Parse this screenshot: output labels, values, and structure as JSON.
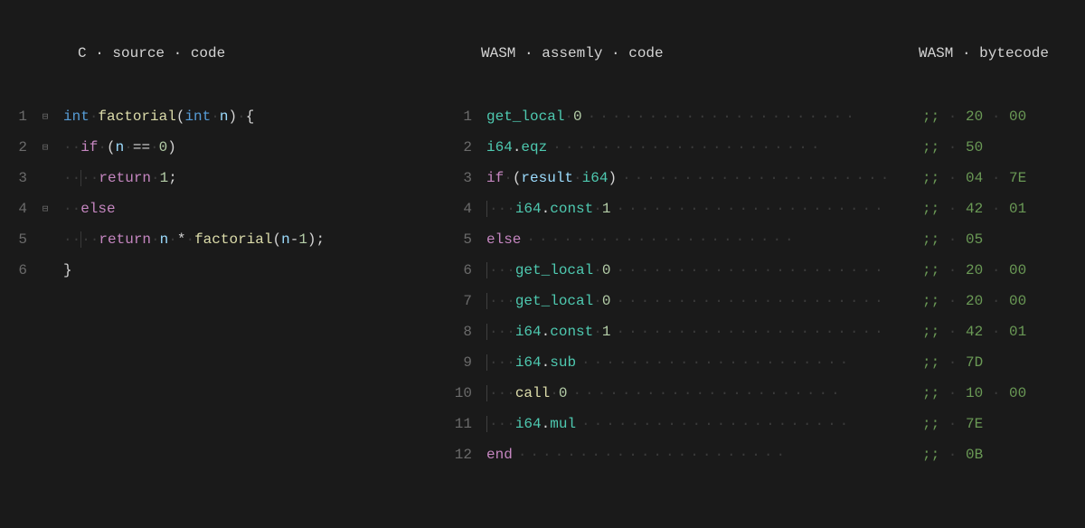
{
  "headers": {
    "c": "C source code",
    "asm": "WASM assemly code",
    "byte": "WASM bytecode"
  },
  "c_lines": [
    {
      "n": "1",
      "fold": "⊟",
      "indent": 0,
      "tokens": [
        [
          "kw-type",
          "int"
        ],
        [
          "ws",
          " "
        ],
        [
          "fn",
          "factorial"
        ],
        [
          "paren",
          "("
        ],
        [
          "kw-type",
          "int"
        ],
        [
          "ws",
          " "
        ],
        [
          "ident",
          "n"
        ],
        [
          "paren",
          ")"
        ],
        [
          "ws",
          " "
        ],
        [
          "punct",
          "{"
        ]
      ]
    },
    {
      "n": "2",
      "fold": "⊟",
      "indent": 1,
      "tokens": [
        [
          "kw-ctrl",
          "if"
        ],
        [
          "ws",
          " "
        ],
        [
          "paren",
          "("
        ],
        [
          "ident",
          "n"
        ],
        [
          "ws",
          " "
        ],
        [
          "op",
          "=="
        ],
        [
          "ws",
          " "
        ],
        [
          "num",
          "0"
        ],
        [
          "paren",
          ")"
        ]
      ]
    },
    {
      "n": "3",
      "fold": "",
      "indent": 2,
      "tokens": [
        [
          "kw-ctrl",
          "return"
        ],
        [
          "ws",
          " "
        ],
        [
          "num",
          "1"
        ],
        [
          "punct",
          ";"
        ]
      ]
    },
    {
      "n": "4",
      "fold": "⊟",
      "indent": 1,
      "tokens": [
        [
          "kw-ctrl",
          "else"
        ]
      ]
    },
    {
      "n": "5",
      "fold": "",
      "indent": 2,
      "tokens": [
        [
          "kw-ctrl",
          "return"
        ],
        [
          "ws",
          " "
        ],
        [
          "ident",
          "n"
        ],
        [
          "ws",
          " "
        ],
        [
          "op",
          "*"
        ],
        [
          "ws",
          " "
        ],
        [
          "fn",
          "factorial"
        ],
        [
          "paren",
          "("
        ],
        [
          "ident",
          "n"
        ],
        [
          "op",
          "-"
        ],
        [
          "num",
          "1"
        ],
        [
          "paren",
          ")"
        ],
        [
          "punct",
          ";"
        ]
      ]
    },
    {
      "n": "6",
      "fold": "",
      "indent": 0,
      "tokens": [
        [
          "punct",
          "}"
        ]
      ]
    }
  ],
  "wasm_lines": [
    {
      "n": "1",
      "indent": 0,
      "tokens": [
        [
          "wasm-op",
          "get_local"
        ],
        [
          "ws",
          " "
        ],
        [
          "num",
          "0"
        ]
      ],
      "bytes": ";; 20 00"
    },
    {
      "n": "2",
      "indent": 0,
      "tokens": [
        [
          "wasm-op",
          "i64"
        ],
        [
          "punct",
          "."
        ],
        [
          "wasm-op",
          "eqz"
        ]
      ],
      "bytes": ";; 50"
    },
    {
      "n": "3",
      "indent": 0,
      "tokens": [
        [
          "wasm-kw",
          "if"
        ],
        [
          "ws",
          " "
        ],
        [
          "paren",
          "("
        ],
        [
          "ident",
          "result"
        ],
        [
          "ws",
          " "
        ],
        [
          "wasm-op",
          "i64"
        ],
        [
          "paren",
          ")"
        ]
      ],
      "bytes": ";; 04 7E"
    },
    {
      "n": "4",
      "indent": 1,
      "tokens": [
        [
          "wasm-op",
          "i64"
        ],
        [
          "punct",
          "."
        ],
        [
          "wasm-op",
          "const"
        ],
        [
          "ws",
          " "
        ],
        [
          "num",
          "1"
        ]
      ],
      "bytes": ";; 42 01"
    },
    {
      "n": "5",
      "indent": 0,
      "tokens": [
        [
          "wasm-kw",
          "else"
        ]
      ],
      "bytes": ";; 05"
    },
    {
      "n": "6",
      "indent": 1,
      "tokens": [
        [
          "wasm-op",
          "get_local"
        ],
        [
          "ws",
          " "
        ],
        [
          "num",
          "0"
        ]
      ],
      "bytes": ";; 20 00"
    },
    {
      "n": "7",
      "indent": 1,
      "tokens": [
        [
          "wasm-op",
          "get_local"
        ],
        [
          "ws",
          " "
        ],
        [
          "num",
          "0"
        ]
      ],
      "bytes": ";; 20 00"
    },
    {
      "n": "8",
      "indent": 1,
      "tokens": [
        [
          "wasm-op",
          "i64"
        ],
        [
          "punct",
          "."
        ],
        [
          "wasm-op",
          "const"
        ],
        [
          "ws",
          " "
        ],
        [
          "num",
          "1"
        ]
      ],
      "bytes": ";; 42 01"
    },
    {
      "n": "9",
      "indent": 1,
      "tokens": [
        [
          "wasm-op",
          "i64"
        ],
        [
          "punct",
          "."
        ],
        [
          "wasm-op",
          "sub"
        ]
      ],
      "bytes": ";; 7D"
    },
    {
      "n": "10",
      "indent": 1,
      "tokens": [
        [
          "wasm-call",
          "call"
        ],
        [
          "ws",
          " "
        ],
        [
          "num",
          "0"
        ]
      ],
      "bytes": ";; 10 00"
    },
    {
      "n": "11",
      "indent": 1,
      "tokens": [
        [
          "wasm-op",
          "i64"
        ],
        [
          "punct",
          "."
        ],
        [
          "wasm-op",
          "mul"
        ]
      ],
      "bytes": ";; 7E"
    },
    {
      "n": "12",
      "indent": 0,
      "tokens": [
        [
          "wasm-kw",
          "end"
        ]
      ],
      "bytes": ";; 0B"
    }
  ],
  "glyphs": {
    "ws_dot": "·",
    "fill": "······················"
  }
}
